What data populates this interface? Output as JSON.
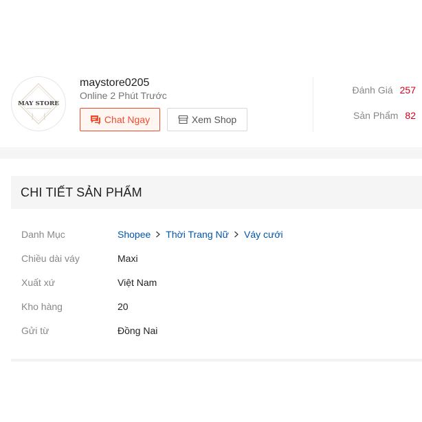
{
  "shop": {
    "name": "maystore0205",
    "status": "Online 2 Phút Trước",
    "logo_text": "MAY STORE",
    "chat_label": "Chat Ngay",
    "view_label": "Xem Shop",
    "stats": [
      {
        "label": "Đánh Giá",
        "value": "257"
      },
      {
        "label": "Sản Phẩm",
        "value": "82"
      }
    ]
  },
  "details": {
    "title": "CHI TIẾT SẢN PHẨM",
    "category_label": "Danh Mục",
    "breadcrumb": [
      "Shopee",
      "Thời Trang Nữ",
      "Váy cưới"
    ],
    "rows": [
      {
        "label": "Chiều dài váy",
        "value": "Maxi"
      },
      {
        "label": "Xuất xứ",
        "value": "Việt Nam"
      },
      {
        "label": "Kho hàng",
        "value": "20"
      },
      {
        "label": "Gửi từ",
        "value": "Đồng Nai"
      }
    ]
  },
  "colors": {
    "accent": "#ee4d2d",
    "link": "#0055aa",
    "stat": "#d0011b"
  }
}
